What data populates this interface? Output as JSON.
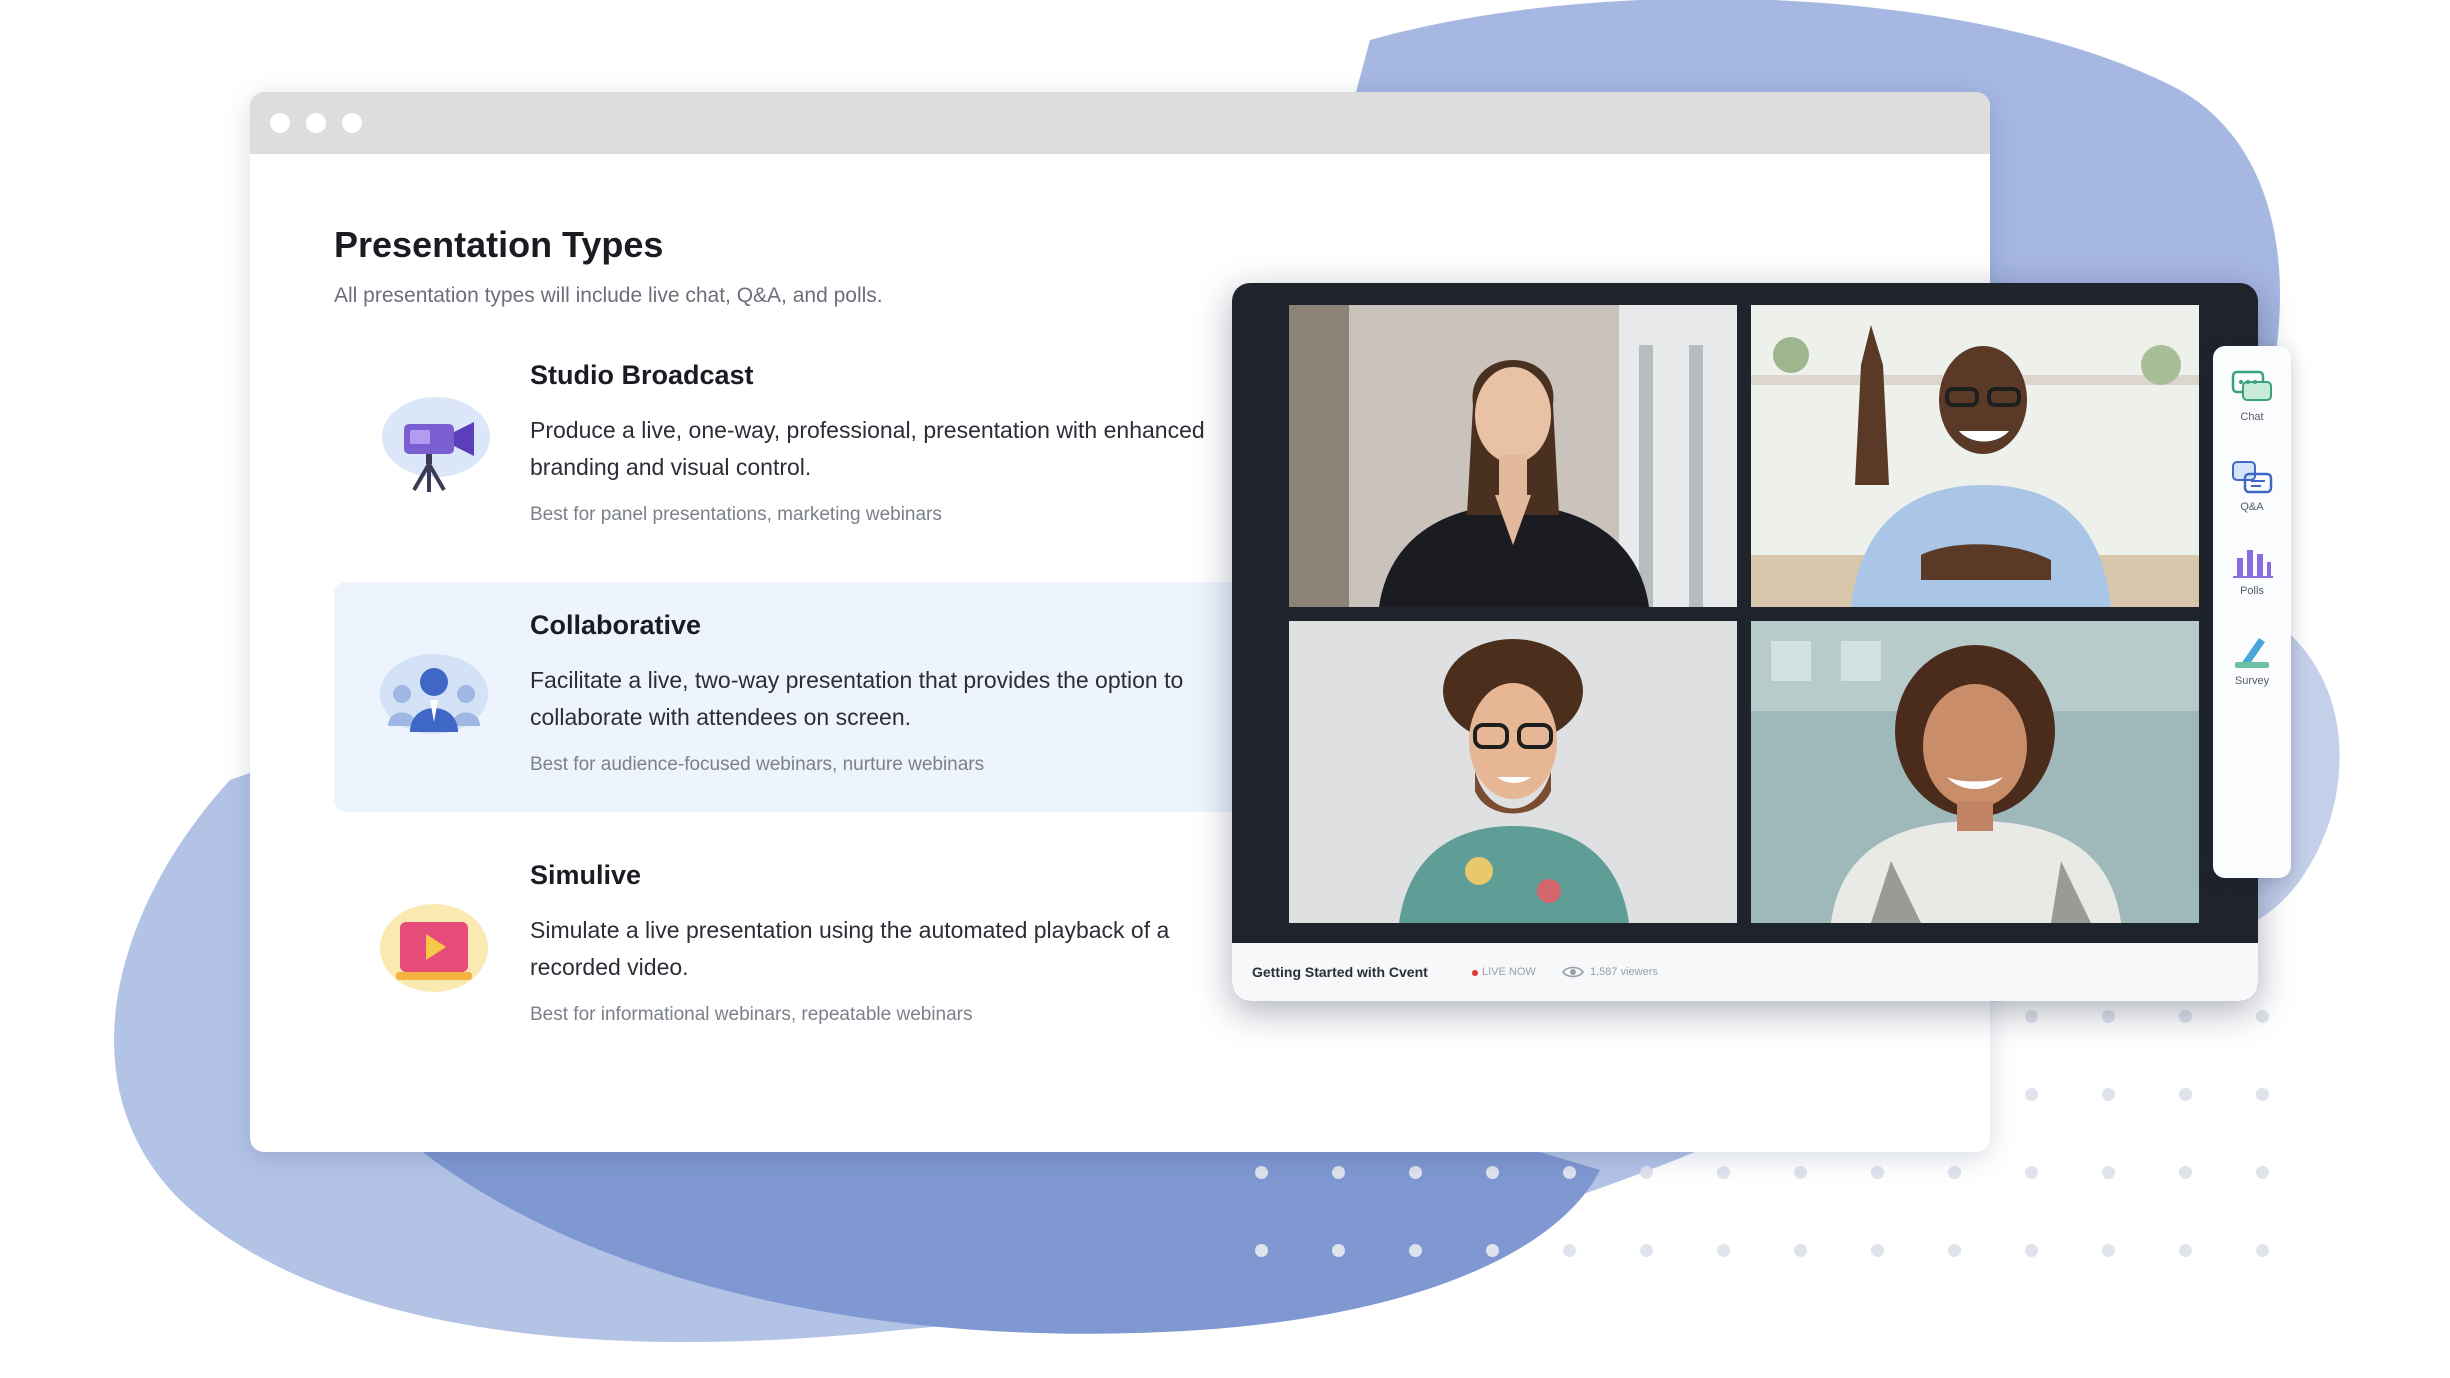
{
  "page": {
    "title": "Presentation Types",
    "subtitle": "All presentation types will include live chat, Q&A, and polls."
  },
  "options": [
    {
      "name": "Studio Broadcast",
      "description": "Produce a live, one-way, professional, presentation with enhanced branding and visual control.",
      "best_for": "Best for panel presentations, marketing webinars",
      "icon": "video-camera-icon",
      "selected": false
    },
    {
      "name": "Collaborative",
      "description": "Facilitate a live, two-way presentation that provides the option to collaborate with attendees on screen.",
      "best_for": "Best for audience-focused webinars, nurture webinars",
      "icon": "people-group-icon",
      "selected": true
    },
    {
      "name": "Simulive",
      "description": "Simulate a live presentation using the automated playback of a recorded video.",
      "best_for": "Best for informational webinars, repeatable webinars",
      "icon": "play-video-icon",
      "selected": false
    }
  ],
  "player": {
    "title": "Getting Started with Cvent",
    "live_label": "LIVE NOW",
    "viewers": "1,587 viewers",
    "participants": [
      {
        "icon": "participant-woman-video"
      },
      {
        "icon": "participant-man-waving-video"
      },
      {
        "icon": "participant-man-glasses-video"
      },
      {
        "icon": "participant-woman-smiling-video"
      }
    ]
  },
  "tools": [
    {
      "label": "Chat",
      "icon": "chat-icon"
    },
    {
      "label": "Q&A",
      "icon": "qa-icon"
    },
    {
      "label": "Polls",
      "icon": "polls-icon"
    },
    {
      "label": "Survey",
      "icon": "survey-icon"
    }
  ],
  "colors": {
    "blob_light": "#b4c4e6",
    "blob_mid": "#8da4d6",
    "blob_dark": "#6f88c7",
    "selected_bg": "#edf4fd",
    "player_bg": "#1f242c",
    "live_red": "#e0362d"
  }
}
